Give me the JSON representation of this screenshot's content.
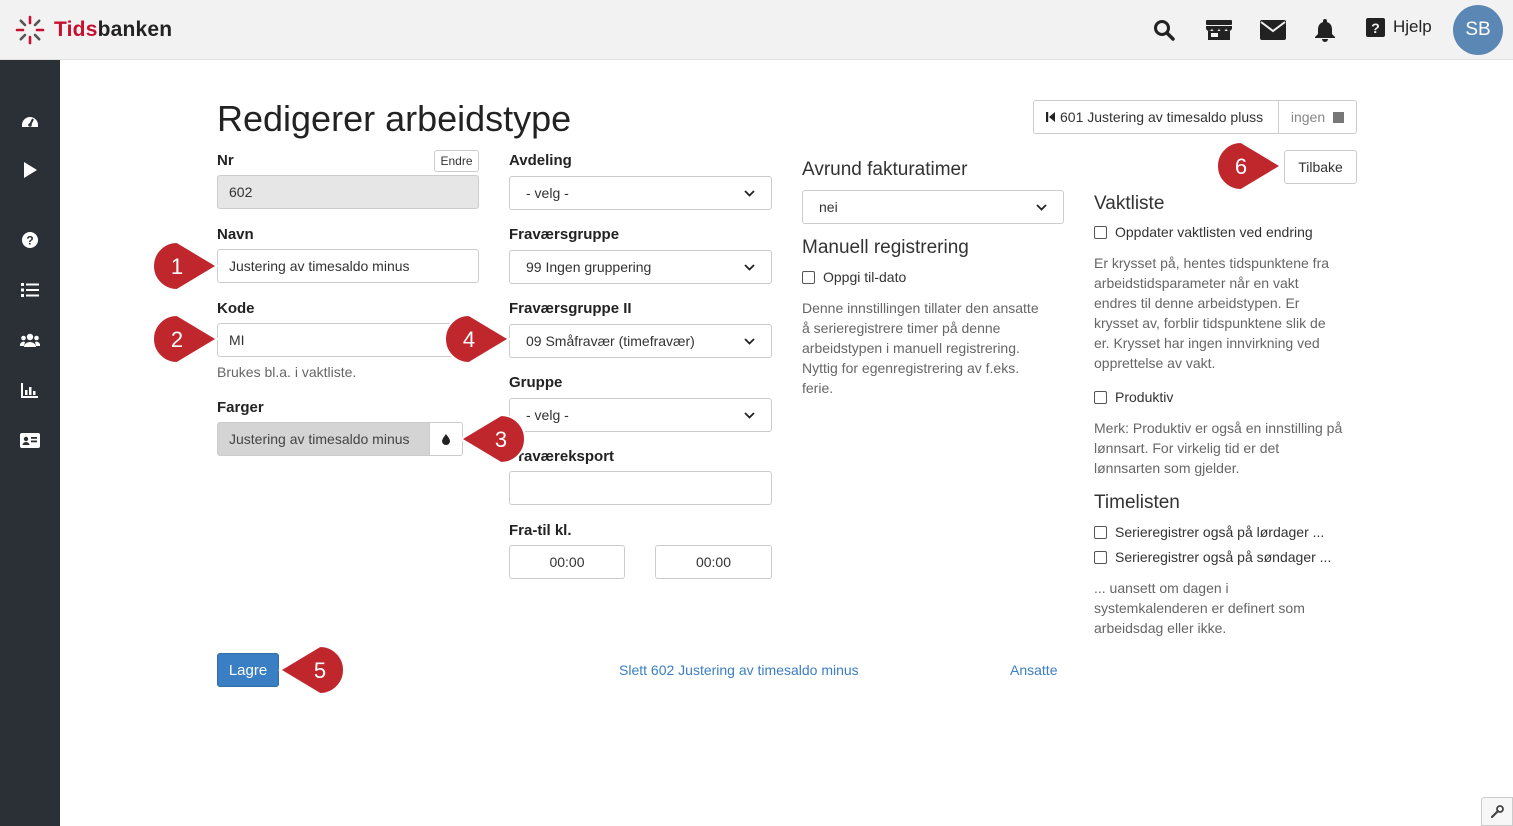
{
  "app": {
    "logo_red": "Tids",
    "logo_dark": "banken"
  },
  "header": {
    "help_label": "Hjelp",
    "avatar_initials": "SB"
  },
  "page": {
    "title": "Redigerer arbeidstype"
  },
  "nav": {
    "prev_label": "601 Justering av timesaldo pluss",
    "next_label": "ingen",
    "back_label": "Tilbake"
  },
  "form": {
    "nr": {
      "label": "Nr",
      "value": "602",
      "change_label": "Endre"
    },
    "navn": {
      "label": "Navn",
      "value": "Justering av timesaldo minus"
    },
    "kode": {
      "label": "Kode",
      "value": "MI",
      "help": "Brukes bl.a. i vaktliste."
    },
    "farger": {
      "label": "Farger",
      "value": "Justering av timesaldo minus",
      "color": "#d4d4d4"
    },
    "avdeling": {
      "label": "Avdeling",
      "value": "- velg -"
    },
    "fravaersgruppe": {
      "label": "Fraværsgruppe",
      "value": "99 Ingen gruppering"
    },
    "fravaersgruppe2": {
      "label": "Fraværsgruppe II",
      "value": "09 Småfravær (timefravær)"
    },
    "gruppe": {
      "label": "Gruppe",
      "value": "- velg -"
    },
    "fravaereksport": {
      "label": "Fraværeksport",
      "value": ""
    },
    "fratil": {
      "label": "Fra-til kl.",
      "from": "00:00",
      "to": "00:00"
    },
    "avrund": {
      "label": "Avrund fakturatimer",
      "value": "nei"
    },
    "manuell": {
      "label": "Manuell registrering",
      "checkbox": "Oppgi til-dato",
      "help": [
        "Denne innstillingen tillater den ansatte",
        "å serieregistrere timer på denne",
        "arbeidstypen i manuell registrering.",
        "Nyttig for egenregistrering av f.eks.",
        "ferie."
      ]
    },
    "vaktliste": {
      "label": "Vaktliste",
      "checkbox": "Oppdater vaktlisten ved endring",
      "help": [
        "Er krysset på, hentes tidspunktene fra",
        "arbeidstidsparameter når en vakt",
        "endres til denne arbeidstypen. Er",
        "krysset av, forblir tidspunktene slik de",
        "er. Krysset har ingen innvirkning ved",
        "opprettelse av vakt."
      ],
      "produktiv": "Produktiv",
      "produktiv_help": [
        "Merk: Produktiv er også en innstilling på",
        "lønnsart. For virkelig tid er det",
        "lønnsarten som gjelder."
      ]
    },
    "timelisten": {
      "label": "Timelisten",
      "lordag": "Serieregistrer også på lørdager ...",
      "sondag": "Serieregistrer også på søndager ...",
      "help": [
        "... uansett om dagen i",
        "systemkalenderen er definert som",
        "arbeidsdag eller ikke."
      ]
    }
  },
  "actions": {
    "save_label": "Lagre",
    "delete_label": "Slett 602 Justering av timesaldo minus",
    "employees_label": "Ansatte"
  },
  "markers": [
    "1",
    "2",
    "3",
    "4",
    "5",
    "6"
  ],
  "colors": {
    "primary": "#3a7ec3",
    "marker": "#c0272d",
    "sidebar": "#2b3037"
  }
}
